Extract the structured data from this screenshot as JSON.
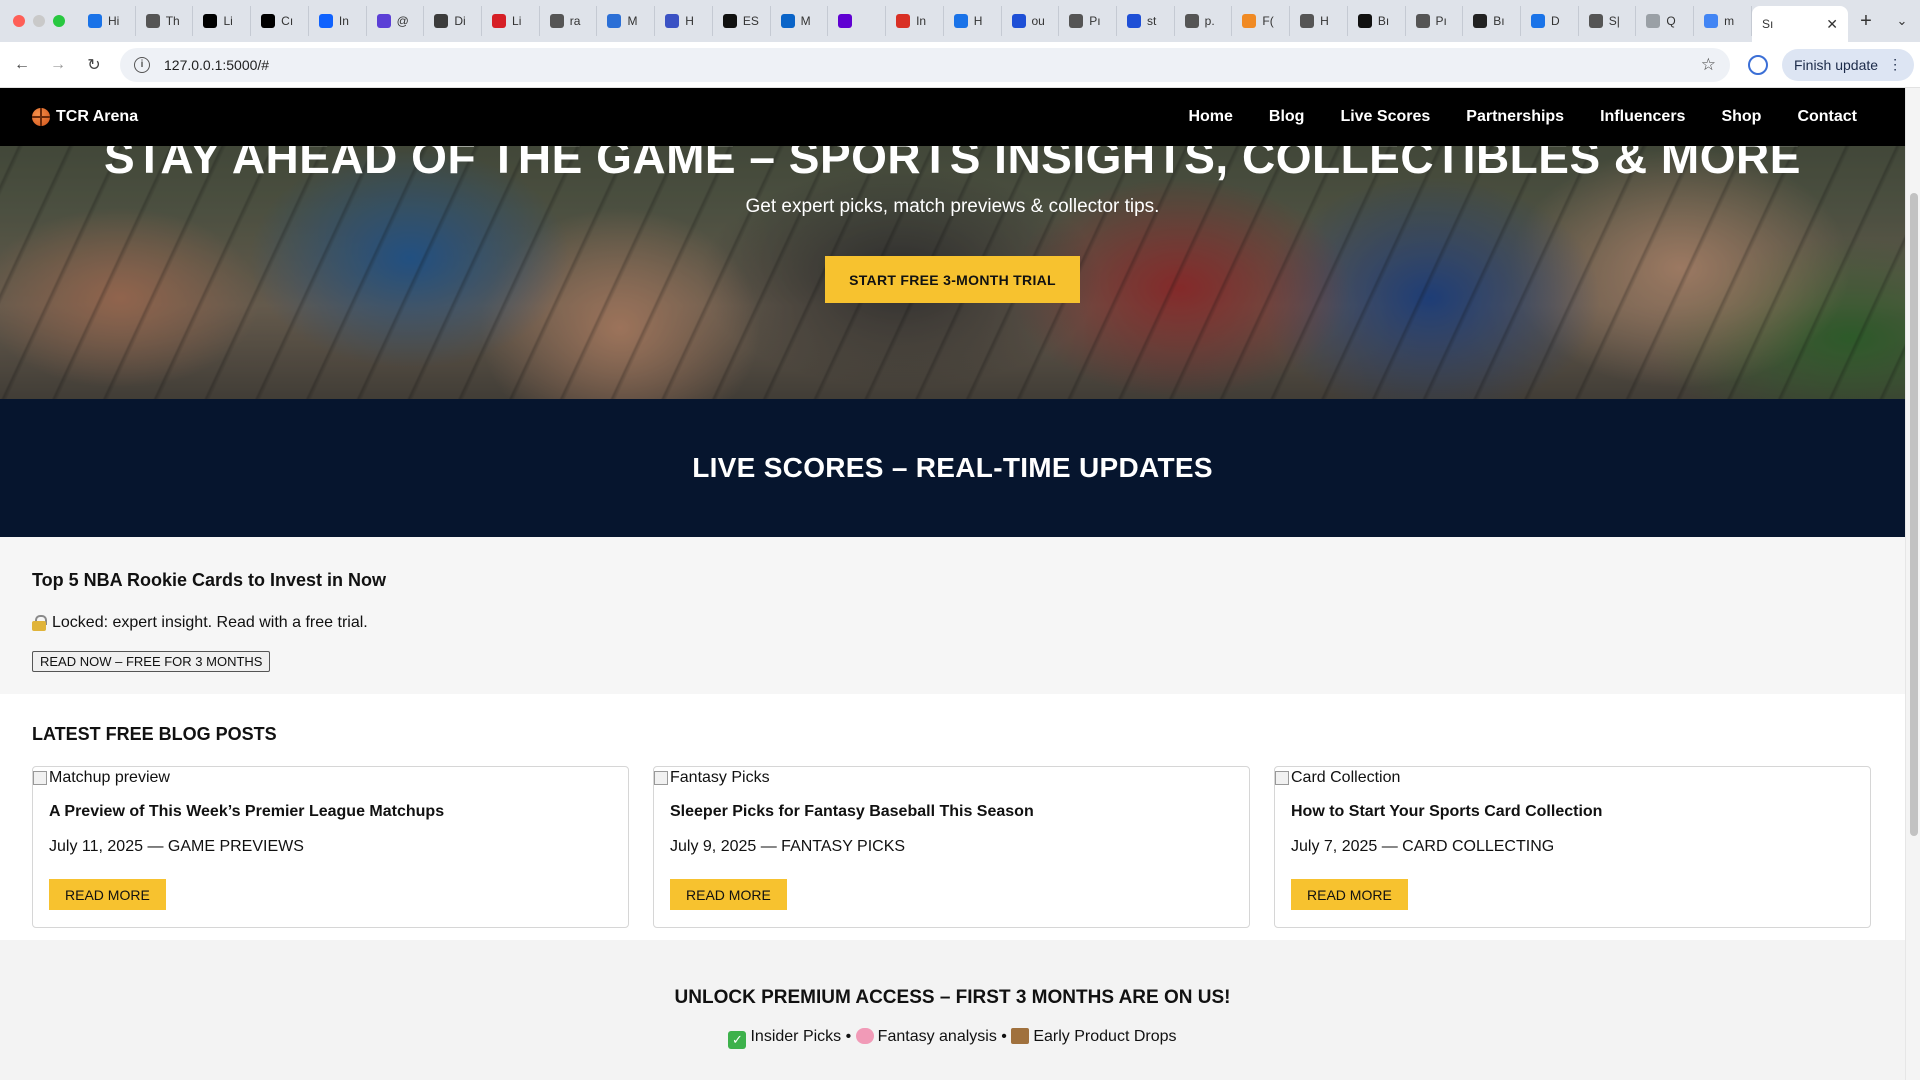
{
  "browser": {
    "tabs": [
      {
        "label": "Hi",
        "icon": "drive-icon",
        "color": "#1a73e8"
      },
      {
        "label": "Th",
        "icon": "globe-icon",
        "color": "#555555"
      },
      {
        "label": "Li",
        "icon": "threads-icon",
        "color": "#000000"
      },
      {
        "label": "Cı",
        "icon": "threads-icon",
        "color": "#000000"
      },
      {
        "label": "In",
        "icon": "mail-icon",
        "color": "#0f62fe"
      },
      {
        "label": "@",
        "icon": "app-icon",
        "color": "#5b3fd6"
      },
      {
        "label": "Di",
        "icon": "wordpress-icon",
        "color": "#3c3c3c"
      },
      {
        "label": "Li",
        "icon": "linkedin-icon",
        "color": "#d61f26"
      },
      {
        "label": "ra",
        "icon": "globe-icon",
        "color": "#555555"
      },
      {
        "label": "M",
        "icon": "app-icon",
        "color": "#2b6fd6"
      },
      {
        "label": "H",
        "icon": "gear-icon",
        "color": "#3b52c4"
      },
      {
        "label": "ES",
        "icon": "github-icon",
        "color": "#111111"
      },
      {
        "label": "M",
        "icon": "outlook-icon",
        "color": "#0a64c8"
      },
      {
        "label": "",
        "icon": "yahoo-icon",
        "color": "#6001d2"
      },
      {
        "label": "In",
        "icon": "gmail-icon",
        "color": "#d93025"
      },
      {
        "label": "H",
        "icon": "drive-icon",
        "color": "#1a73e8"
      },
      {
        "label": "ou",
        "icon": "app-icon",
        "color": "#1e4fd6"
      },
      {
        "label": "Pı",
        "icon": "globe-icon",
        "color": "#555555"
      },
      {
        "label": "st",
        "icon": "app-icon",
        "color": "#1e4fd6"
      },
      {
        "label": "p.",
        "icon": "globe-icon",
        "color": "#555555"
      },
      {
        "label": "F(",
        "icon": "app-icon",
        "color": "#f08a24"
      },
      {
        "label": "H",
        "icon": "globe-icon",
        "color": "#555555"
      },
      {
        "label": "Bı",
        "icon": "app-icon",
        "color": "#111111"
      },
      {
        "label": "Pı",
        "icon": "globe-icon",
        "color": "#555555"
      },
      {
        "label": "Bı",
        "icon": "app-icon",
        "color": "#222222"
      },
      {
        "label": "D",
        "icon": "download-icon",
        "color": "#1a73e8"
      },
      {
        "label": "S|",
        "icon": "globe-icon",
        "color": "#555555"
      },
      {
        "label": "Q",
        "icon": "app-icon",
        "color": "#9aa0a6"
      },
      {
        "label": "m",
        "icon": "google-icon",
        "color": "#4285f4"
      }
    ],
    "active_tab": "Sı",
    "url": "127.0.0.1:5000/#",
    "update_label": "Finish update"
  },
  "nav": {
    "brand": "TCR Arena",
    "links": [
      "Home",
      "Blog",
      "Live Scores",
      "Partnerships",
      "Influencers",
      "Shop",
      "Contact"
    ]
  },
  "hero": {
    "title": "STAY AHEAD OF THE GAME – SPORTS INSIGHTS, COLLECTIBLES & MORE",
    "subtitle": "Get expert picks, match previews & collector tips.",
    "cta": "START FREE 3-MONTH TRIAL"
  },
  "live_scores": {
    "title": "LIVE SCORES – REAL-TIME UPDATES"
  },
  "locked_article": {
    "title": "Top 5 NBA Rookie Cards to Invest in Now",
    "note": "Locked: expert insight. Read with a free trial.",
    "button": "READ NOW – FREE FOR 3 MONTHS"
  },
  "blog": {
    "heading": "LATEST FREE BLOG POSTS",
    "posts": [
      {
        "image_alt": "Matchup preview",
        "title": "A Preview of This Week’s Premier League Matchups",
        "meta": "July 11, 2025 — GAME PREVIEWS",
        "button": "READ MORE"
      },
      {
        "image_alt": "Fantasy Picks",
        "title": "Sleeper Picks for Fantasy Baseball This Season",
        "meta": "July 9, 2025 — FANTASY PICKS",
        "button": "READ MORE"
      },
      {
        "image_alt": "Card Collection",
        "title": "How to Start Your Sports Card Collection",
        "meta": "July 7, 2025 — CARD COLLECTING",
        "button": "READ MORE"
      }
    ]
  },
  "premium": {
    "title": "UNLOCK PREMIUM ACCESS – FIRST 3 MONTHS ARE ON US!",
    "perks": [
      "Insider Picks",
      "Fantasy analysis",
      "Early Product Drops"
    ],
    "separator": " • "
  },
  "colors": {
    "accent": "#f7c22f",
    "nav_bg": "#000000",
    "live_bg": "#06152e"
  }
}
